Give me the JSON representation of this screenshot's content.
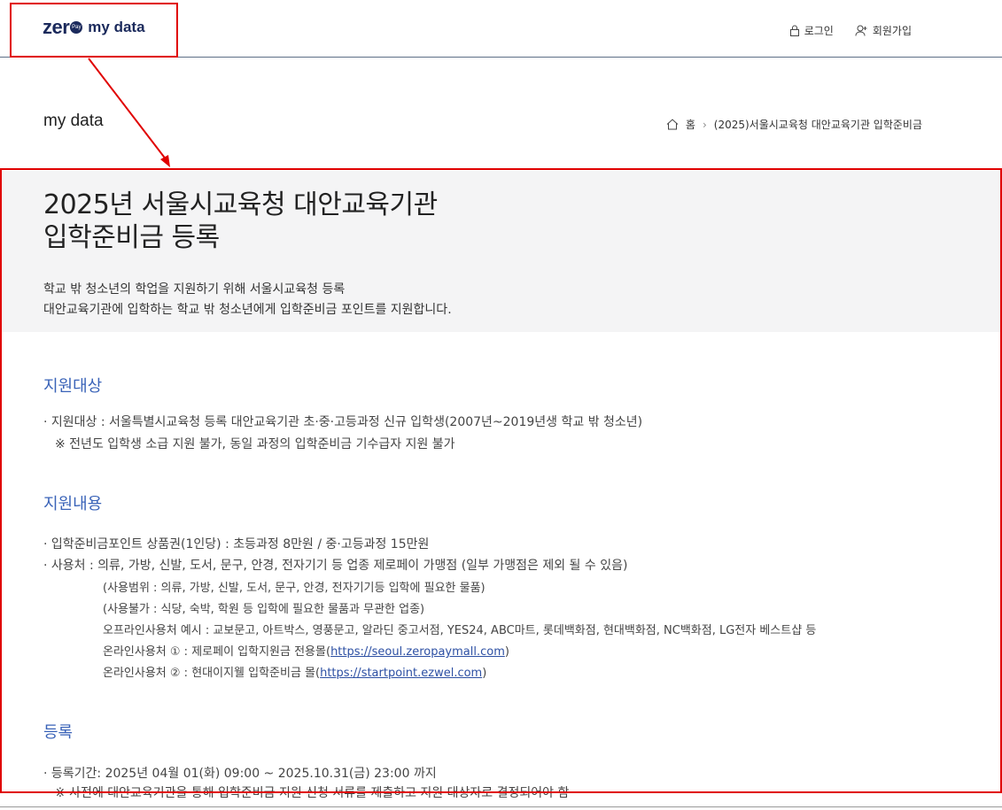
{
  "header": {
    "logo_zero": "zer",
    "logo_pay": "Pay",
    "logo_mydata": "my data",
    "nav": {
      "login": "로그인",
      "signup": "회원가입"
    }
  },
  "page_head": "my data",
  "breadcrumb": {
    "home": "홈",
    "current": "(2025)서울시교육청 대안교육기관 입학준비금"
  },
  "hero": {
    "title_line1": "2025년 서울시교육청 대안교육기관",
    "title_line2": "입학준비금 등록",
    "desc_line1": "학교 밖 청소년의 학업을 지원하기 위해 서울시교육청 등록",
    "desc_line2": "대안교육기관에 입학하는 학교 밖 청소년에게 입학준비금 포인트를 지원합니다."
  },
  "sections": {
    "target": {
      "title": "지원대상",
      "line1": "· 지원대상 : 서울특별시교육청 등록 대안교육기관 초·중·고등과정 신규 입학생(2007년~2019년생 학교 밖 청소년)",
      "line2": "※ 전년도 입학생 소급 지원 불가, 동일 과정의 입학준비금 기수급자 지원 불가"
    },
    "content": {
      "title": "지원내용",
      "line1": "· 입학준비금포인트 상품권(1인당) : 초등과정 8만원 / 중·고등과정 15만원",
      "line2": "· 사용처 : 의류, 가방, 신발, 도서, 문구, 안경, 전자기기 등 업종 제로페이 가맹점 (일부 가맹점은 제외 될 수 있음)",
      "line3": "(사용범위 : 의류, 가방, 신발, 도서, 문구, 안경, 전자기기등 입학에 필요한 물품)",
      "line4": "(사용불가 : 식당, 숙박, 학원 등 입학에 필요한 물품과 무관한 업종)",
      "line5": "오프라인사용처 예시 : 교보문고, 아트박스, 영풍문고, 알라딘 중고서점, YES24, ABC마트, 롯데백화점, 현대백화점, NC백화점, LG전자 베스트샵 등",
      "online1_prefix": "온라인사용처 ① : 제로페이 입학지원금 전용몰(",
      "online1_link": "https://seoul.zeropaymall.com",
      "online1_suffix": ")",
      "online2_prefix": "온라인사용처 ② : 현대이지웰 입학준비금 몰(",
      "online2_link": "https://startpoint.ezwel.com",
      "online2_suffix": ")"
    },
    "register": {
      "title": "등록",
      "line1": "· 등록기간: 2025년 04월 01(화) 09:00 ~ 2025.10.31(금) 23:00 까지",
      "line2": "※ 사전에 대안교육기관을 통해 입학준비금 지원 신청 서류를 제출하고 지원 대상자로 결정되어야 함"
    }
  },
  "colors": {
    "annotation": "#e00000",
    "section_title": "#3a63b8",
    "hero_bg": "#f4f4f5",
    "brand": "#1b2a5c"
  }
}
